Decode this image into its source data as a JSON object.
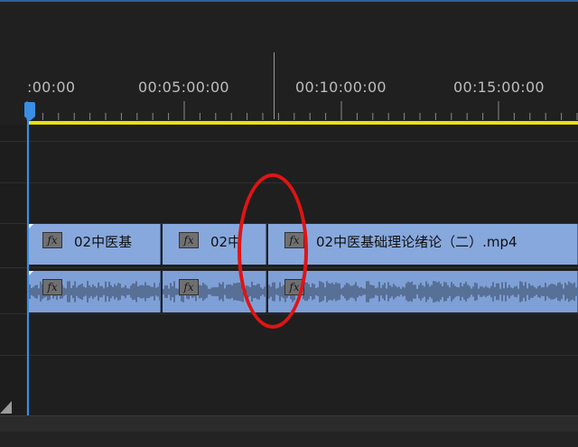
{
  "ruler": {
    "timecodes": [
      ":00:00",
      "00:05:00:00",
      "00:10:00:00",
      "00:15:00:00"
    ]
  },
  "clips": {
    "video": [
      {
        "name": "02中医基"
      },
      {
        "name": "02中"
      },
      {
        "name": "02中医基础理论绪论（二）.mp4"
      }
    ],
    "fx_label": "fx"
  },
  "colors": {
    "background": "#1f1f1f",
    "clip": "#87a8dd",
    "playhead": "#3a8ee6",
    "work_area": "#e8e10b",
    "annotation": "#e01414"
  }
}
